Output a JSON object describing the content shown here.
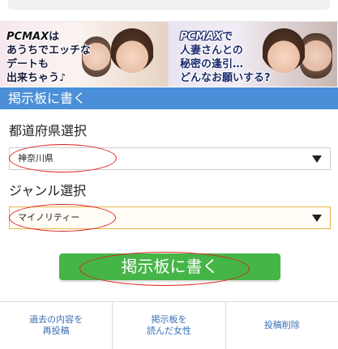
{
  "banners": [
    {
      "brand": "PCMAX",
      "line1": "は",
      "line2": "あうちでエッチな",
      "line3": "デートも",
      "line4": "出来ちゃう♪"
    },
    {
      "brand": "PCMAX",
      "line1": "で",
      "line2": "人妻さんとの",
      "line3": "秘密の逢引…",
      "line4": "どんなお願いする?"
    }
  ],
  "section_header": "掲示板に書く",
  "prefecture": {
    "label": "都道府県選択",
    "selected": "神奈川県"
  },
  "genre": {
    "label": "ジャンル選択",
    "selected": "マイノリティー"
  },
  "post_button": "掲示板に書く",
  "bottom_nav": [
    "過去の内容を\n再投稿",
    "掲示板を\n読んだ女性",
    "投稿削除"
  ],
  "colors": {
    "header_blue": "#4a8fd8",
    "button_green": "#45b547",
    "nav_link": "#3a6fb5",
    "annotation_red": "#e02020"
  }
}
